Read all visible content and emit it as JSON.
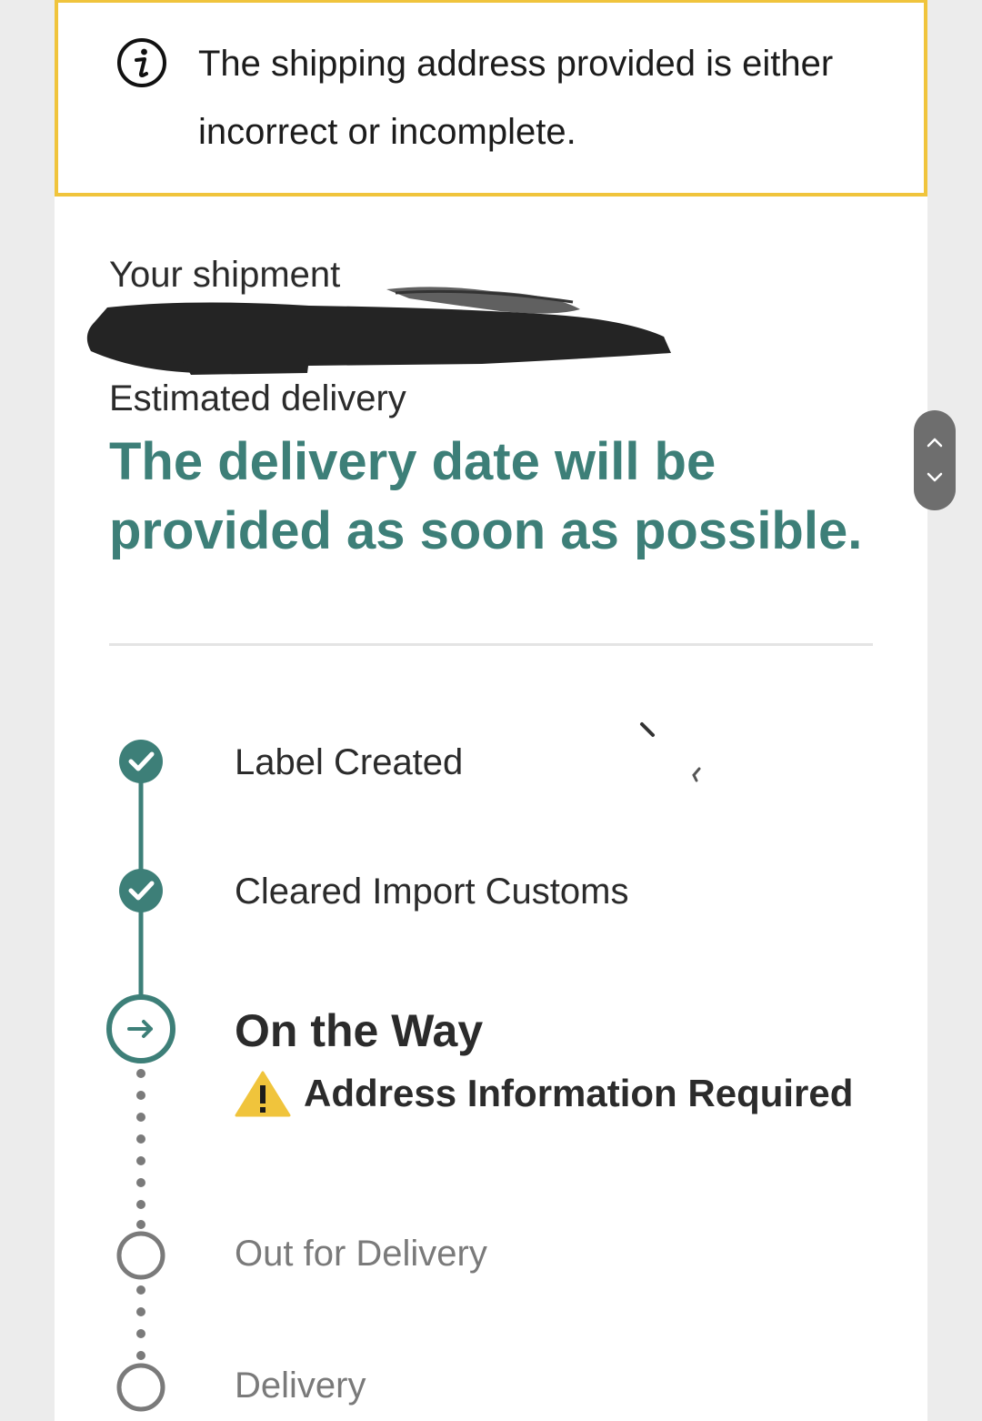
{
  "alert": {
    "icon": "info-icon",
    "message": "The shipping address provided is either incorrect or incomplete.",
    "border_color": "#f0c43c"
  },
  "shipment": {
    "label": "Your shipment",
    "tracking_number": "redacted"
  },
  "estimated_delivery": {
    "label": "Estimated delivery",
    "value": "The delivery date will be provided as soon as possible.",
    "color": "#3d7f78"
  },
  "timeline": {
    "accent_color": "#3d7f78",
    "steps": [
      {
        "label": "Label Created",
        "status": "complete",
        "icon": "check-icon"
      },
      {
        "label": "Cleared Import Customs",
        "status": "complete",
        "icon": "check-icon"
      },
      {
        "label": "On the Way",
        "status": "current",
        "icon": "arrow-right-icon"
      },
      {
        "label": "Out for Delivery",
        "status": "pending",
        "icon": "empty-circle-icon"
      },
      {
        "label": "Delivery",
        "status": "pending",
        "icon": "empty-circle-icon"
      }
    ],
    "warning": {
      "icon": "warning-icon",
      "text": "Address Information Required"
    }
  },
  "scroll_control": {
    "up_icon": "chevron-up-icon",
    "down_icon": "chevron-down-icon"
  }
}
